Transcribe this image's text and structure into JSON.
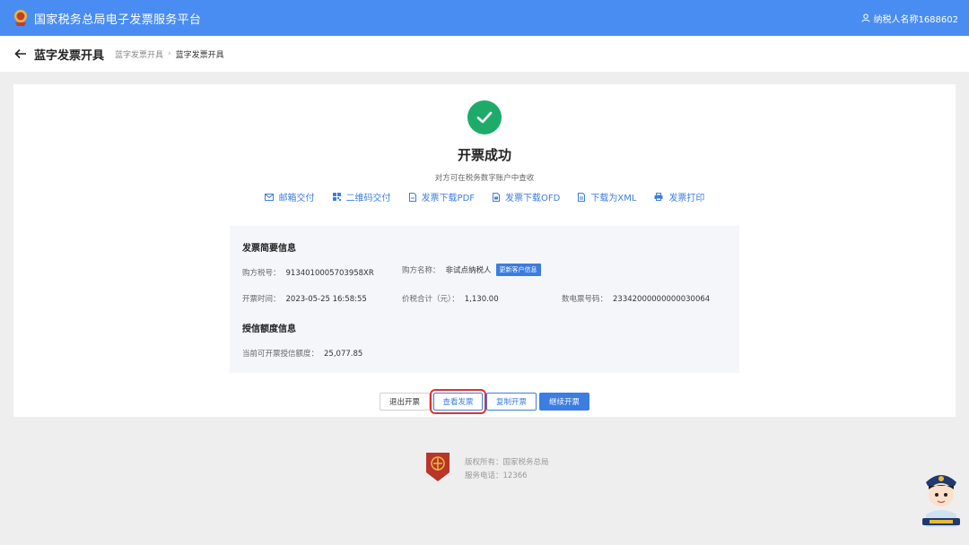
{
  "header": {
    "app_title": "国家税务总局电子发票服务平台",
    "user_name": "纳税人名称1688602"
  },
  "breadcrumb": {
    "page_title": "蓝字发票开具",
    "items": [
      "蓝字发票开具",
      "蓝字发票开具"
    ]
  },
  "result": {
    "title": "开票成功",
    "subtitle": "对方可在税务数字账户中查收",
    "actions": [
      {
        "label": "邮箱交付",
        "icon": "mail-icon"
      },
      {
        "label": "二维码交付",
        "icon": "qrcode-icon"
      },
      {
        "label": "发票下载PDF",
        "icon": "pdf-file-icon"
      },
      {
        "label": "发票下载OFD",
        "icon": "ofd-file-icon"
      },
      {
        "label": "下载为XML",
        "icon": "xml-file-icon"
      },
      {
        "label": "发票打印",
        "icon": "printer-icon"
      }
    ]
  },
  "summary": {
    "title": "发票简要信息",
    "buyer_tax_no_label": "购方税号：",
    "buyer_tax_no": "9134010005703958XR",
    "buyer_name_label": "购方名称：",
    "buyer_name": "非试点纳税人",
    "update_tag": "更新客户信息",
    "issue_time_label": "开票时间：",
    "issue_time": "2023-05-25 16:58:55",
    "total_label": "价税合计（元）：",
    "total": "1,130.00",
    "invoice_no_label": "数电票号码：",
    "invoice_no": "23342000000000030064"
  },
  "credit": {
    "title": "授信额度信息",
    "available_label": "当前可开票授信额度：",
    "available": "25,077.85"
  },
  "buttons": {
    "exit": "退出开票",
    "view": "查看发票",
    "copy": "复制开票",
    "continue": "继续开票"
  },
  "footer": {
    "copyright": "版权所有：国家税务总局",
    "phone": "服务电话：12366"
  },
  "colors": {
    "header_bg": "#4a8df2",
    "accent": "#3b7de0",
    "success": "#1eab6a",
    "highlight": "#e03030"
  }
}
